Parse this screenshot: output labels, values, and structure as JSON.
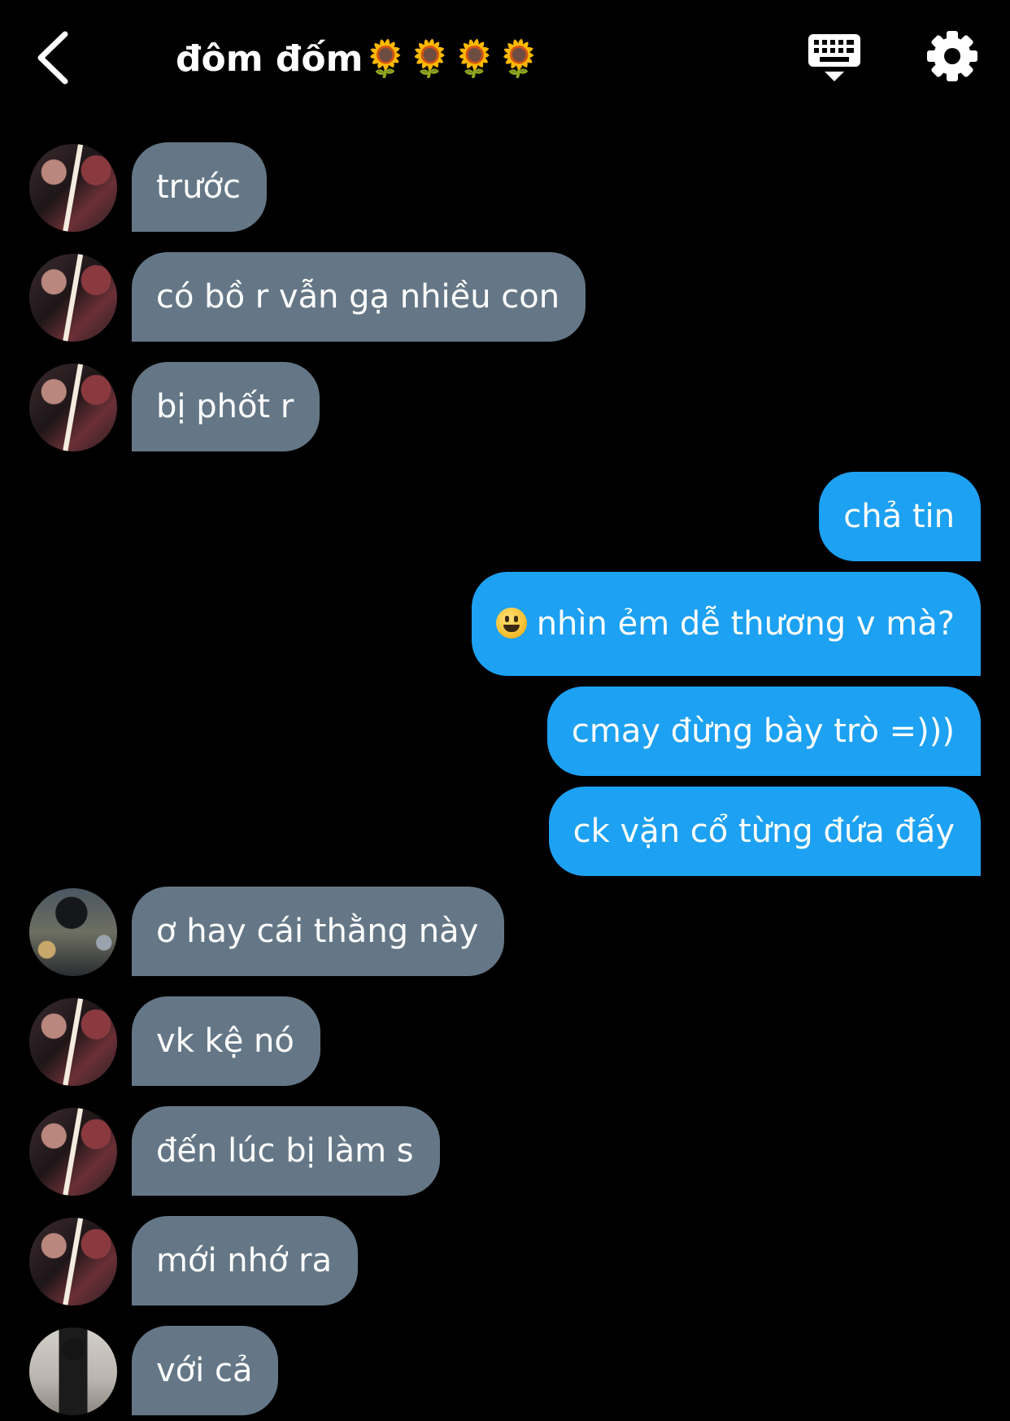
{
  "header": {
    "title": "đôm đốm🌻🌻🌻🌻",
    "back_icon": "chevron-left-icon",
    "keyboard_icon": "keyboard-icon",
    "settings_icon": "gear-icon"
  },
  "colors": {
    "background": "#000000",
    "incoming_bubble": "#657786",
    "outgoing_bubble": "#1da1f2",
    "text": "#ffffff"
  },
  "messages": [
    {
      "direction": "incoming",
      "avatar": "avatar-a",
      "text": "trước"
    },
    {
      "direction": "incoming",
      "avatar": "avatar-a",
      "text": "có bồ r vẫn gạ nhiều con"
    },
    {
      "direction": "incoming",
      "avatar": "avatar-a",
      "text": "bị phốt r"
    },
    {
      "direction": "outgoing",
      "text": "chả tin"
    },
    {
      "direction": "outgoing",
      "emoji": "grinning-face",
      "text": "nhìn ẻm dễ thương v mà?"
    },
    {
      "direction": "outgoing",
      "text": "cmay đừng bày trò =)))"
    },
    {
      "direction": "outgoing",
      "text": "ck vặn cổ từng đứa đấy"
    },
    {
      "direction": "incoming",
      "avatar": "avatar-b",
      "text": "ơ hay cái thằng này"
    },
    {
      "direction": "incoming",
      "avatar": "avatar-a",
      "text": "vk kệ nó"
    },
    {
      "direction": "incoming",
      "avatar": "avatar-a",
      "text": "đến lúc bị làm s"
    },
    {
      "direction": "incoming",
      "avatar": "avatar-a",
      "text": "mới nhớ ra"
    },
    {
      "direction": "incoming",
      "avatar": "avatar-c",
      "text": "với cả"
    }
  ]
}
